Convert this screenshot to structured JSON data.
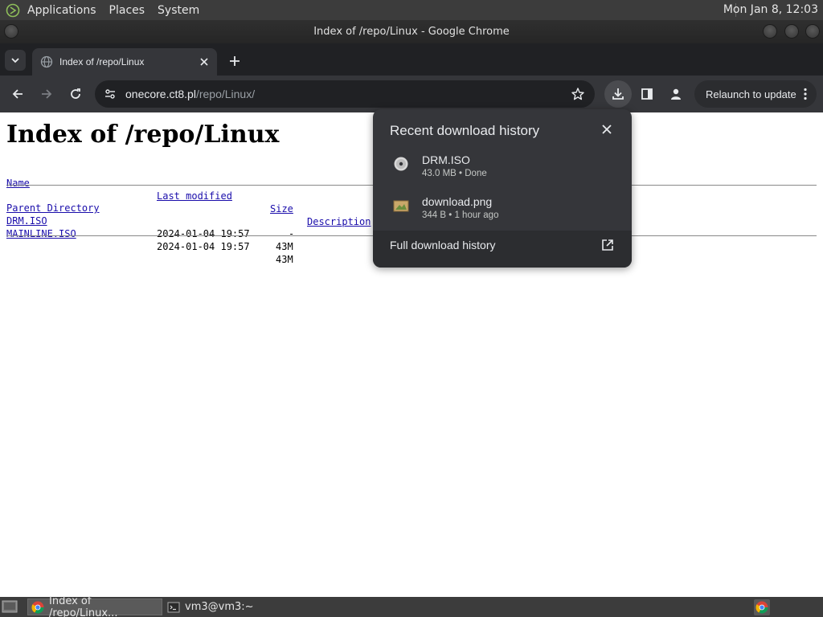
{
  "top_panel": {
    "menus": [
      "Applications",
      "Places",
      "System"
    ],
    "clock": "Mon Jan  8, 12:03"
  },
  "window": {
    "title": "Index of /repo/Linux - Google Chrome"
  },
  "browser": {
    "tab": {
      "title": "Index of /repo/Linux"
    },
    "omnibox": {
      "host": "onecore.ct8.pl",
      "path": "/repo/Linux/"
    },
    "relaunch_label": "Relaunch to update"
  },
  "page": {
    "heading": "Index of /repo/Linux",
    "columns": {
      "name": "Name",
      "last_modified": "Last modified",
      "size": "Size",
      "description": "Description"
    },
    "rows": [
      {
        "name": "Parent Directory",
        "last_modified": "",
        "size": "-"
      },
      {
        "name": "DRM.ISO",
        "last_modified": "2024-01-04 19:57",
        "size": "43M"
      },
      {
        "name": "MAINLINE.ISO",
        "last_modified": "2024-01-04 19:57",
        "size": "43M"
      }
    ]
  },
  "downloads": {
    "title": "Recent download history",
    "items": [
      {
        "name": "DRM.ISO",
        "meta": "43.0 MB • Done",
        "icon": "disc-icon"
      },
      {
        "name": "download.png",
        "meta": "344 B • 1 hour ago",
        "icon": "image-file-icon"
      }
    ],
    "footer": "Full download history"
  },
  "taskbar": {
    "tasks": [
      "Index of /repo/Linux...",
      "vm3@vm3:~"
    ]
  },
  "colors": {
    "panel": "#3c3c3c",
    "tabstrip": "#202124",
    "toolbar": "#35363a",
    "link": "#1a0dab"
  }
}
